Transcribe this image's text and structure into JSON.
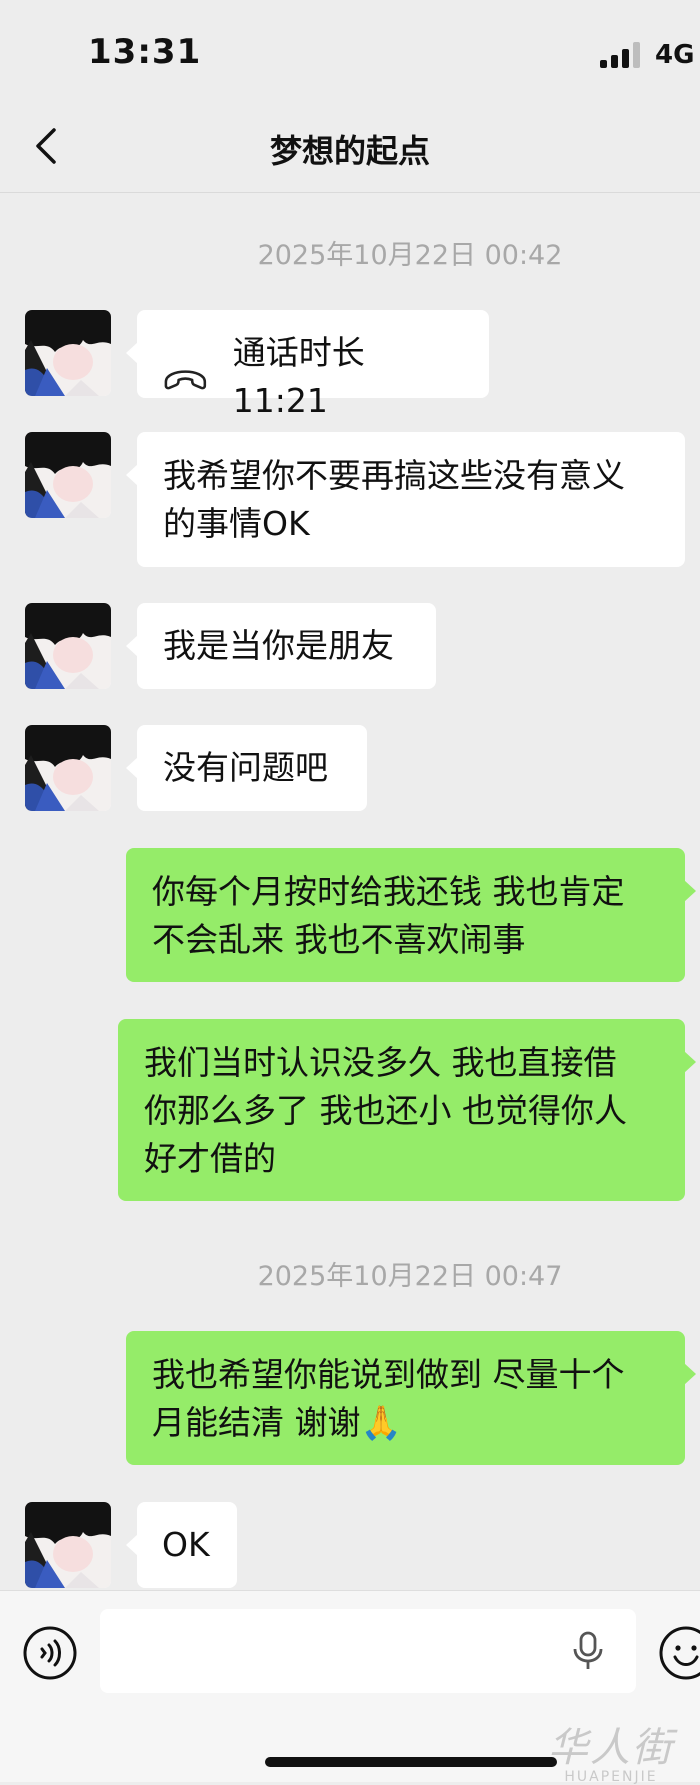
{
  "status_bar": {
    "time": "13:31",
    "network": "4G"
  },
  "header": {
    "title": "梦想的起点",
    "back_icon": "chevron-left-icon"
  },
  "timestamps": [
    "2025年10月22日 00:42",
    "2025年10月22日 00:47"
  ],
  "messages": [
    {
      "side": "in",
      "type": "call",
      "icon": "phone-hangup-icon",
      "text": "通话时长 11:21"
    },
    {
      "side": "in",
      "lines": [
        "我希望你不要再搞这些没有意义",
        "的事情OK"
      ]
    },
    {
      "side": "in",
      "lines": [
        "我是当你是朋友"
      ]
    },
    {
      "side": "in",
      "lines": [
        "没有问题吧"
      ]
    },
    {
      "side": "out",
      "lines": [
        "你每个月按时给我还钱 我也肯定",
        "不会乱来  我也不喜欢闹事"
      ]
    },
    {
      "side": "out",
      "lines": [
        "我们当时认识没多久 我也直接借",
        "你那么多了 我也还小 也觉得你人",
        "好才借的"
      ]
    },
    {
      "side": "out",
      "lines": [
        "我也希望你能说到做到 尽量十个",
        "月能结清 谢谢🙏"
      ]
    },
    {
      "side": "in",
      "lines": [
        "OK"
      ]
    }
  ],
  "input_bar": {
    "voice_icon": "voice-mode-icon",
    "mic_icon": "microphone-icon",
    "emoji_icon": "emoji-icon"
  },
  "colors": {
    "background": "#ededed",
    "outgoing": "#95ec69",
    "incoming": "#ffffff",
    "timestamp": "#a8a8a8"
  },
  "watermark": {
    "brand_cn": "华人街",
    "brand_en": "HUAPENJIE"
  }
}
